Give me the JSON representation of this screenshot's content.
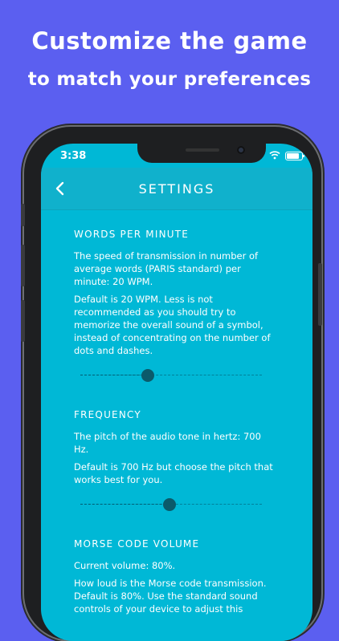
{
  "promo": {
    "line1": "Customize the game",
    "line2": "to match your preferences"
  },
  "status": {
    "time": "3:38"
  },
  "nav": {
    "title": "SETTINGS"
  },
  "sections": [
    {
      "title": "WORDS PER MINUTE",
      "desc": "The speed of transmission in number of average words (PARIS standard) per minute: 20 WPM.",
      "note": "Default is 20 WPM. Less is not recommended as you should try to memorize the overall sound of a symbol, instead of concentrating on the number of dots and dashes.",
      "slider_value": 0.37
    },
    {
      "title": "FREQUENCY",
      "desc": "The pitch of the audio tone in hertz: 700 Hz.",
      "note": "Default is 700 Hz but choose the pitch that works best for you.",
      "slider_value": 0.49
    },
    {
      "title": "MORSE CODE VOLUME",
      "desc": "Current volume: 80%.",
      "note": "How loud is the Morse code transmission. Default is 80%. Use the standard sound controls of your device to adjust this"
    }
  ],
  "colors": {
    "background": "#5b5ff0",
    "screen": "#00b8d6",
    "navbar": "#10b1cc",
    "thumb": "#0b5a6a"
  },
  "icons": [
    "back-chevron-icon",
    "wifi-icon",
    "battery-icon"
  ]
}
